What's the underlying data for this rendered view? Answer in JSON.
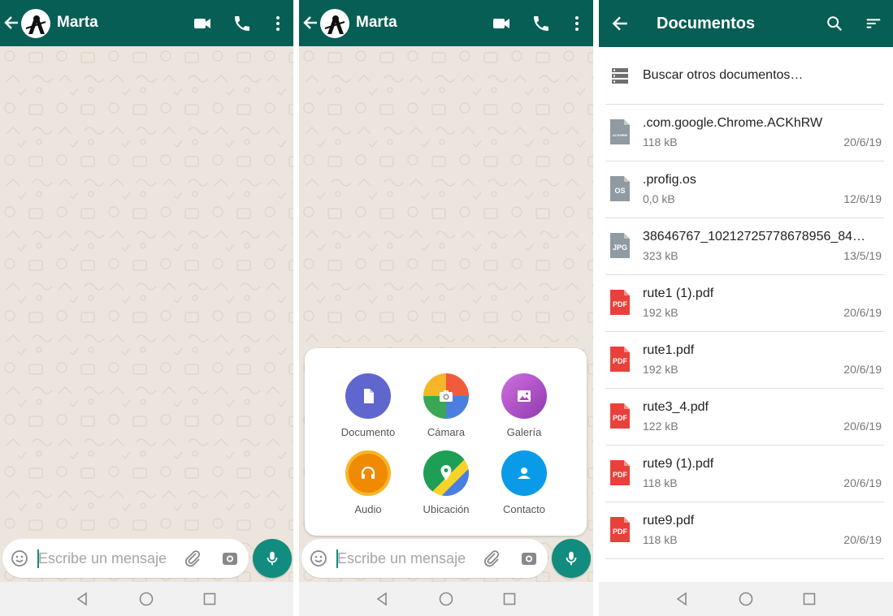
{
  "chat": {
    "contact_name": "Marta",
    "input_placeholder": "Escribe un mensaje"
  },
  "attach_menu": {
    "items": [
      {
        "label": "Documento",
        "icon": "document-icon",
        "color": "#5f66cd"
      },
      {
        "label": "Cámara",
        "icon": "camera-icon",
        "color": "#f05a3d"
      },
      {
        "label": "Galería",
        "icon": "gallery-icon",
        "color": "#bf59cf"
      },
      {
        "label": "Audio",
        "icon": "headphones-icon",
        "color": "#f08a00"
      },
      {
        "label": "Ubicación",
        "icon": "location-icon",
        "color": "#1f9e55"
      },
      {
        "label": "Contacto",
        "icon": "contact-icon",
        "color": "#0a9be8"
      }
    ]
  },
  "documents": {
    "title": "Documentos",
    "browse_label": "Buscar otros documentos…",
    "files": [
      {
        "name": ".com.google.Chrome.ACKhRW",
        "size": "118 kB",
        "date": "20/6/19",
        "type": "ACKHRW",
        "icon_color": "#8f9aa1"
      },
      {
        "name": ".profig.os",
        "size": "0,0 kB",
        "date": "12/6/19",
        "type": "OS",
        "icon_color": "#8f9aa1"
      },
      {
        "name": "38646767_10212725778678956_84…",
        "size": "323 kB",
        "date": "13/5/19",
        "type": "JPG",
        "icon_color": "#8f9aa1"
      },
      {
        "name": "rute1 (1).pdf",
        "size": "192 kB",
        "date": "20/6/19",
        "type": "PDF",
        "icon_color": "#e8413b"
      },
      {
        "name": "rute1.pdf",
        "size": "192 kB",
        "date": "20/6/19",
        "type": "PDF",
        "icon_color": "#e8413b"
      },
      {
        "name": "rute3_4.pdf",
        "size": "122 kB",
        "date": "20/6/19",
        "type": "PDF",
        "icon_color": "#e8413b"
      },
      {
        "name": "rute9 (1).pdf",
        "size": "118 kB",
        "date": "20/6/19",
        "type": "PDF",
        "icon_color": "#e8413b"
      },
      {
        "name": "rute9.pdf",
        "size": "118 kB",
        "date": "20/6/19",
        "type": "PDF",
        "icon_color": "#e8413b"
      }
    ]
  },
  "colors": {
    "header": "#075e54",
    "accent": "#128c7e",
    "chat_background": "#ece5dd"
  }
}
